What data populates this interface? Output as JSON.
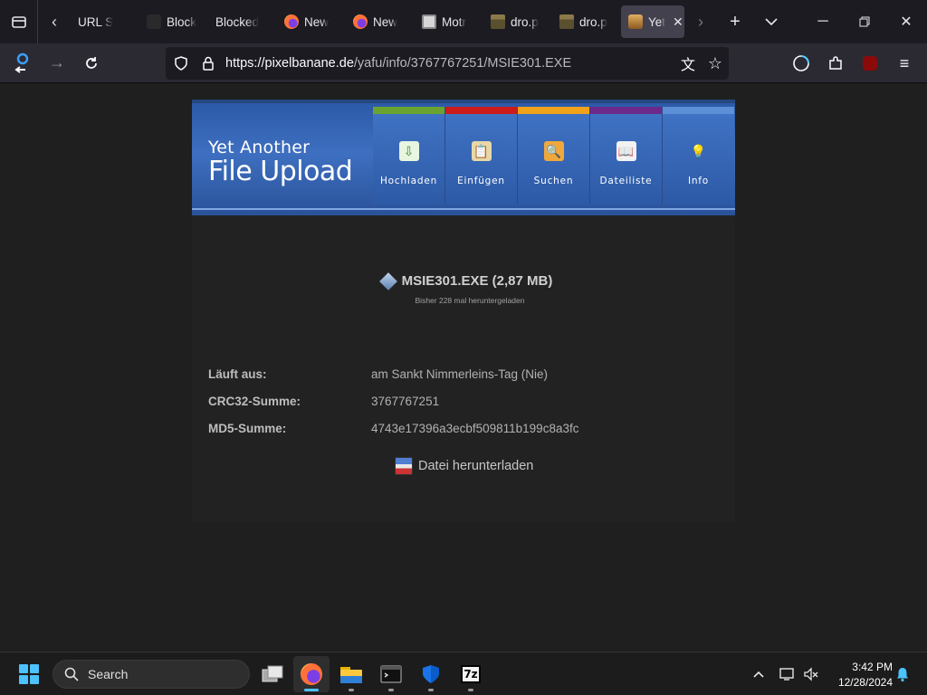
{
  "browser": {
    "tabs": [
      {
        "label": "URL S",
        "icon": "dark"
      },
      {
        "label": "Block",
        "icon": "dark"
      },
      {
        "label": "Blocked",
        "icon": "none"
      },
      {
        "label": "New",
        "icon": "firefox"
      },
      {
        "label": "New",
        "icon": "firefox"
      },
      {
        "label": "Motr",
        "icon": "monitor"
      },
      {
        "label": "dro.p",
        "icon": "folder"
      },
      {
        "label": "dro.p",
        "icon": "folder"
      },
      {
        "label": "Yet",
        "icon": "yafu",
        "active": true
      }
    ],
    "url": {
      "host": "https://pixelbanane.de",
      "path": "/yafu/info/3767767251/MSIE301.EXE"
    }
  },
  "site": {
    "title_line1": "Yet Another",
    "title_line2": "File Upload",
    "menu": [
      {
        "label": "Hochladen",
        "color": "#6aa32f",
        "icon": "upload-icon"
      },
      {
        "label": "Einfügen",
        "color": "#cc1b1b",
        "icon": "paste-icon"
      },
      {
        "label": "Suchen",
        "color": "#f0a21b",
        "icon": "search-folder-icon"
      },
      {
        "label": "Dateiliste",
        "color": "#6b2a8c",
        "icon": "book-icon"
      },
      {
        "label": "Info",
        "color": "#5c8fd6",
        "icon": "lightbulb-icon"
      }
    ]
  },
  "file": {
    "name": "MSIE301.EXE (2,87 MB)",
    "downloads_note": "Bisher 228 mal heruntergeladen",
    "rows": [
      {
        "key": "Läuft aus:",
        "value": "am Sankt Nimmerleins-Tag (Nie)"
      },
      {
        "key": "CRC32-Summe:",
        "value": "3767767251"
      },
      {
        "key": "MD5-Summe:",
        "value": "4743e17396a3ecbf509811b199c8a3fc"
      }
    ],
    "download_label": "Datei herunterladen"
  },
  "taskbar": {
    "search_label": "Search",
    "time": "3:42 PM",
    "date": "12/28/2024"
  },
  "colors": {
    "accent": "#4cc2ff",
    "banner": "#3e6fc0"
  }
}
